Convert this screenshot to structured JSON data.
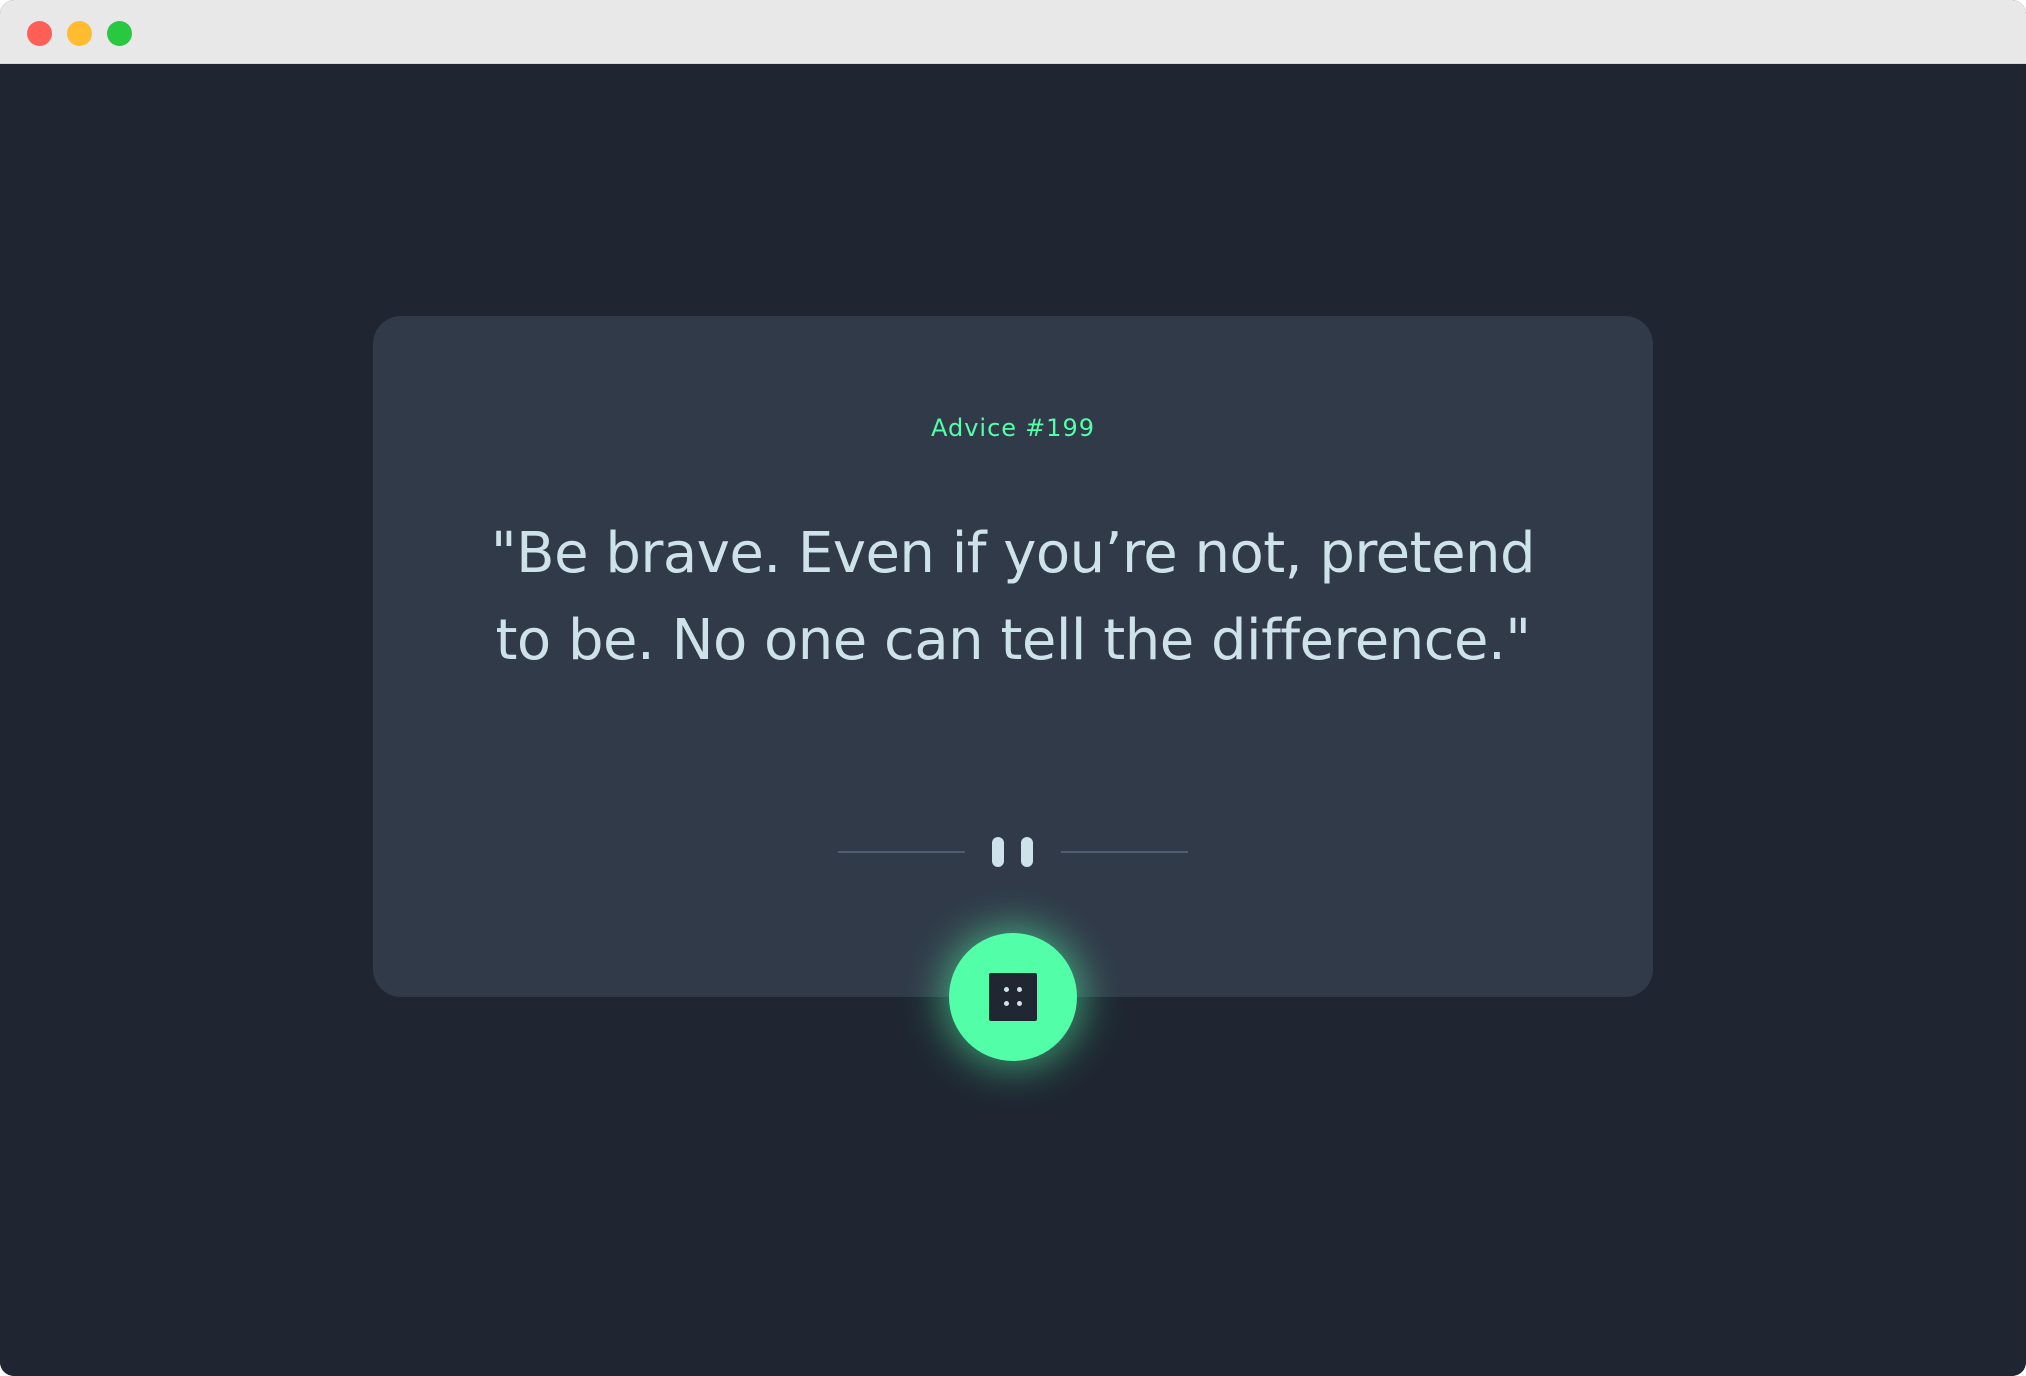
{
  "window": {
    "traffic_lights": {
      "close_color": "#ff5f57",
      "minimize_color": "#febc2e",
      "zoom_color": "#28c840"
    }
  },
  "card": {
    "label": "Advice",
    "advice_id": "#199",
    "quote": "\"Be brave. Even if you’re not, pretend to be. No one can tell the difference.\"",
    "divider_icon": "pause-icon",
    "button_icon": "dice-icon"
  },
  "colors": {
    "background": "#1f2632",
    "card": "#313a49",
    "accent": "#52ffa8",
    "text": "#cee3e9"
  }
}
